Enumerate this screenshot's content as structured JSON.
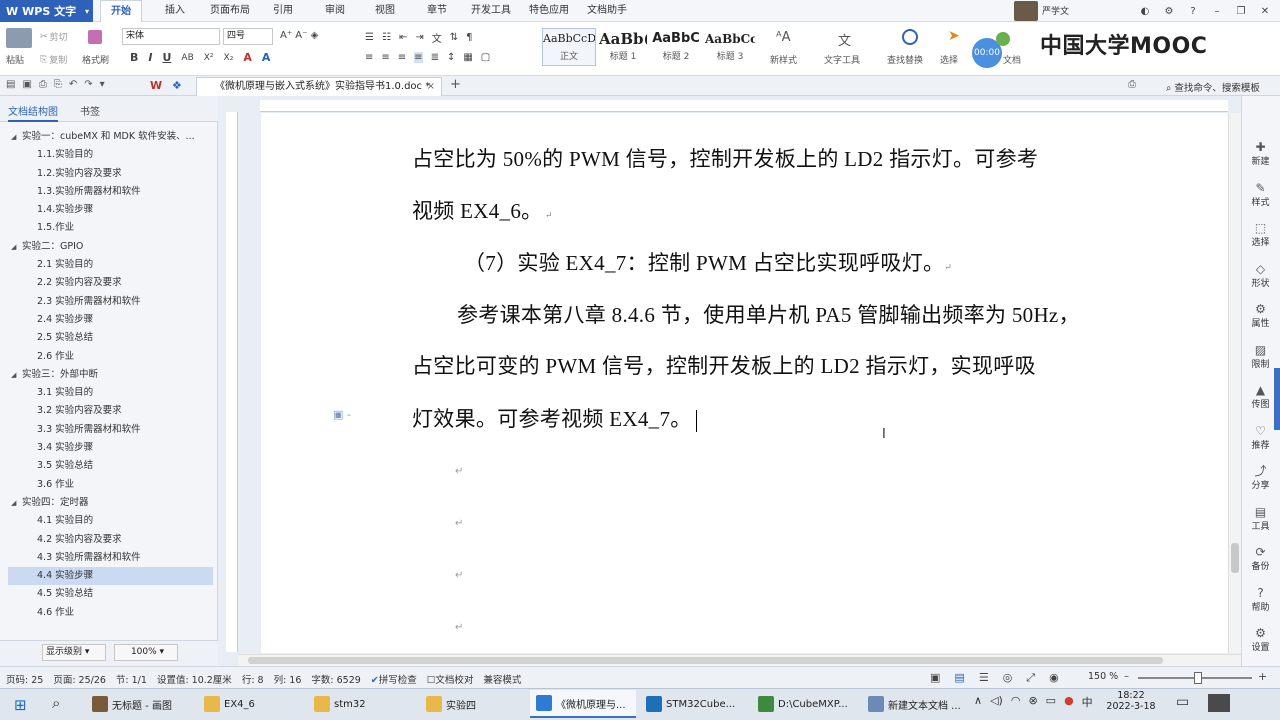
{
  "app": {
    "name": "WPS 文字"
  },
  "menu": {
    "tabs": [
      "开始",
      "插入",
      "页面布局",
      "引用",
      "审阅",
      "视图",
      "章节",
      "开发工具",
      "特色应用",
      "文档助手"
    ],
    "active": "开始"
  },
  "user": {
    "name": "严学文"
  },
  "ribbon": {
    "paste": "粘贴",
    "cut": "剪切",
    "copy": "复制",
    "format_painter": "格式刷",
    "font_name": "宋体",
    "font_size": "四号",
    "styles": [
      {
        "sample": "AaBbCcD",
        "label": "正文"
      },
      {
        "sample": "AaBb(",
        "label": "标题 1"
      },
      {
        "sample": "AaBbC",
        "label": "标题 2"
      },
      {
        "sample": "AaBbCc",
        "label": "标题 3"
      }
    ],
    "new_style": "新样式",
    "text_tools": "文字工具",
    "find_replace": "查找替换",
    "select": "选择",
    "doc_label": "文档",
    "timer": "00:00"
  },
  "watermark": "中国大学MOOC",
  "tabbar": {
    "document_title": "《微机原理与嵌入式系统》实验指导书1.0.doc *",
    "search": "查找命令、搜索模板"
  },
  "leftpanel": {
    "tabs": [
      "文档结构图",
      "书签"
    ],
    "toc": [
      {
        "level": 1,
        "text": "实验一：cubeMX 和 MDK 软件安装、..."
      },
      {
        "level": 2,
        "text": "1.1.实验目的"
      },
      {
        "level": 2,
        "text": "1.2.实验内容及要求"
      },
      {
        "level": 2,
        "text": "1.3.实验所需器材和软件"
      },
      {
        "level": 2,
        "text": "1.4.实验步骤"
      },
      {
        "level": 2,
        "text": "1.5.作业"
      },
      {
        "level": 1,
        "text": "实验二：GPIO"
      },
      {
        "level": 2,
        "text": "2.1 实验目的"
      },
      {
        "level": 2,
        "text": "2.2 实验内容及要求"
      },
      {
        "level": 2,
        "text": "2.3 实验所需器材和软件"
      },
      {
        "level": 2,
        "text": "2.4 实验步骤"
      },
      {
        "level": 2,
        "text": "2.5 实验总结"
      },
      {
        "level": 2,
        "text": "2.6 作业"
      },
      {
        "level": 1,
        "text": "实验三：外部中断"
      },
      {
        "level": 2,
        "text": "3.1 实验目的"
      },
      {
        "level": 2,
        "text": "3.2 实验内容及要求"
      },
      {
        "level": 2,
        "text": "3.3 实验所需器材和软件"
      },
      {
        "level": 2,
        "text": "3.4 实验步骤"
      },
      {
        "level": 2,
        "text": "3.5 实验总结"
      },
      {
        "level": 2,
        "text": "3.6 作业"
      },
      {
        "level": 1,
        "text": "实验四：定时器"
      },
      {
        "level": 2,
        "text": "4.1 实验目的"
      },
      {
        "level": 2,
        "text": "4.2 实验内容及要求"
      },
      {
        "level": 2,
        "text": "4.3 实验所需器材和软件"
      },
      {
        "level": 2,
        "text": "4.4 实验步骤",
        "selected": true
      },
      {
        "level": 2,
        "text": "4.5 实验总结"
      },
      {
        "level": 2,
        "text": "4.6 作业"
      }
    ],
    "display_level": "显示级别",
    "zoom": "100%"
  },
  "document": {
    "lines": [
      "占空比为 50%的 PWM 信号，控制开发板上的 LD2 指示灯。可参考",
      "视频 EX4_6。",
      "（7）实验 EX4_7：控制 PWM 占空比实现呼吸灯。",
      "参考课本第八章 8.4.6 节，使用单片机 PA5 管脚输出频率为 50Hz，",
      "占空比可变的 PWM 信号，控制开发板上的 LD2 指示灯，实现呼吸",
      "灯效果。可参考视频 EX4_7。"
    ]
  },
  "rightpanel": [
    "新建",
    "样式",
    "选择",
    "形状",
    "属性",
    "限制",
    "传图",
    "推荐",
    "分享",
    "工具",
    "备份",
    "帮助",
    "设置"
  ],
  "status": {
    "page": "页码: 25",
    "pages": "页面: 25/26",
    "section": "节: 1/1",
    "setting": "设置值: 10.2厘米",
    "row": "行: 8",
    "col": "列: 16",
    "words": "字数: 6529",
    "spell": "拼写检查",
    "proof": "文档校对",
    "compat": "兼容模式",
    "zoom": "150 %"
  },
  "taskbar": {
    "items": [
      "无标题 - 画图",
      "EX4_6",
      "stm32",
      "实验四",
      "《微机原理与...",
      "STM32Cube...",
      "D:\\CubeMXP...",
      "新建文本文档 ..."
    ],
    "time": "18:22",
    "date": "2022-3-18"
  }
}
